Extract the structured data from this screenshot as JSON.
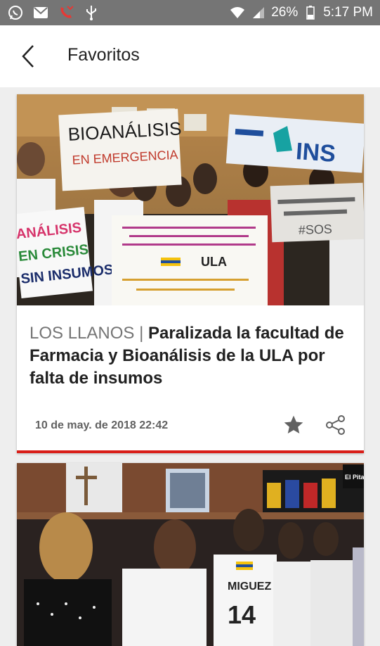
{
  "status_bar": {
    "battery": "26%",
    "time": "5:17 PM",
    "icons": [
      "whatsapp-icon",
      "gmail-icon",
      "missed-call-icon",
      "usb-icon",
      "wifi-icon",
      "signal-icon",
      "battery-icon"
    ]
  },
  "app_bar": {
    "title": "Favoritos",
    "back_icon": "arrow-back-icon"
  },
  "articles": [
    {
      "section": "LOS LLANOS",
      "separator": "|",
      "headline": "Paralizada la facultad de Farmacia y Bioanálisis de la ULA por falta de insumos",
      "date": "10 de may. de 2018 22:42",
      "favorite_icon": "star-icon",
      "share_icon": "share-icon",
      "image_signs": {
        "sign1_line1": "BIOANÁLISIS",
        "sign1_line2": "EN EMERGENCIA",
        "sign2_line1": "ANÁLISIS",
        "sign2_line2": "EN CRISIS",
        "sign2_line3": "SIN INSUMOS",
        "sign3": "ULA",
        "banner": "INS",
        "sign4": "#SOS"
      },
      "accent_color": "#d91e18"
    },
    {
      "image_text": {
        "jersey1": "MIGUEZ",
        "jersey_num": "14",
        "logo": "El Pitazo"
      }
    }
  ]
}
